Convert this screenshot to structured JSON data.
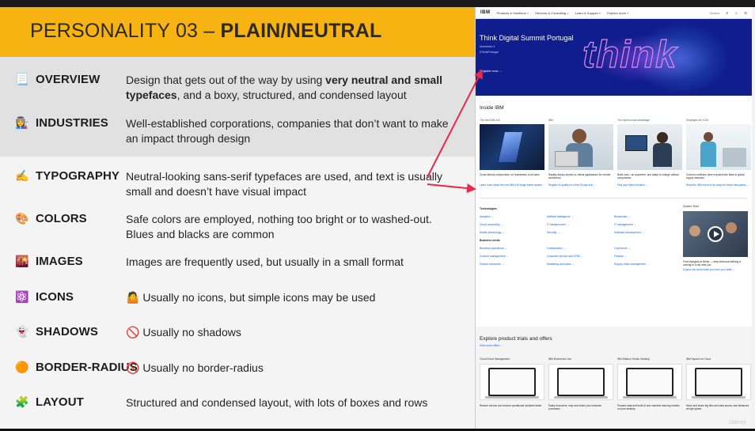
{
  "slide": {
    "title_prefix": "PERSONALITY 03 – ",
    "title_bold": "PLAIN/NEUTRAL",
    "rows": [
      {
        "emoji": "📃",
        "label": "OVERVIEW",
        "desc_parts": [
          "Design that gets out of the way by using ",
          "very neutral and small typefaces",
          ", and a boxy, structured, and condensed layout"
        ]
      },
      {
        "emoji": "👩‍🏭",
        "label": "INDUSTRIES",
        "desc": "Well-established corporations, companies that don’t want to make an impact through design"
      },
      {
        "emoji": "✍️",
        "label": "TYPOGRAPHY",
        "desc": "Neutral-looking sans-serif typefaces are used, and text is usually small and doesn’t have visual impact"
      },
      {
        "emoji": "🎨",
        "label": "COLORS",
        "desc": "Safe colors are employed, nothing too bright or to washed-out. Blues and blacks are common"
      },
      {
        "emoji": "🌇",
        "label": "IMAGES",
        "desc": "Images are frequently used, but usually in a small format"
      },
      {
        "emoji": "⚛️",
        "label": "ICONS",
        "desc_emoji": "🤷",
        "desc": "Usually no icons, but simple icons may be used"
      },
      {
        "emoji": "👻",
        "label": "SHADOWS",
        "desc_emoji": "🚫",
        "desc": "Usually no shadows"
      },
      {
        "emoji": "🟠",
        "label": "BORDER-RADIUS",
        "desc_emoji": "🚫",
        "desc": "Usually no border-radius"
      },
      {
        "emoji": "🧩",
        "label": "LAYOUT",
        "desc": "Structured and condensed layout, with lots of boxes and rows"
      }
    ],
    "colors": {
      "accent": "#f6b311",
      "arrow": "#e8294a",
      "ibm_blue": "#0f1e8c",
      "ibm_link": "#0f62fe"
    }
  },
  "ibm": {
    "logo": "IBM",
    "nav": [
      "Products & Solutions ˅",
      "Services & Consulting ˅",
      "Learn & Support ˅",
      "Explore more ˅"
    ],
    "search": "Search",
    "hero": {
      "title": "Think Digital Summit Portugal",
      "date": "November 4",
      "hashtag": "#ThinkPortugal",
      "link": "Register now →",
      "art_word": "think"
    },
    "inside_title": "Inside IBM",
    "cards": [
      {
        "caption": "The new IBM z15",
        "text": "Cloud without compromise, for businesses of all sizes",
        "link": "Learn more about the new IBM z15 single frame system →"
      },
      {
        "caption": "IBM",
        "text": "Rapidly deploy access to critical applications for remote workforces",
        "link": "Register to qualify for a free 60-day trial →"
      },
      {
        "caption": "The hybrid cloud advantage",
        "text": "Build once, run anywhere, and adapt to change without compromise",
        "link": "Find your hybrid solution →"
      },
      {
        "caption": "Strategies for SCM",
        "text": "Current conditions have exposed dire flaws in global supply networks",
        "link": "Read the IBM report to be ready for future disruptions →"
      }
    ],
    "tech_head": "Technologies",
    "tech": [
      [
        "Analytics →",
        "Artificial intelligence →",
        "Blockchain →"
      ],
      [
        "Cloud computing →",
        "IT infrastructure →",
        "IT management →"
      ],
      [
        "Mobile technology →",
        "Security →",
        "Software development →"
      ]
    ],
    "biz_head": "Business needs",
    "biz": [
      [
        "Business operations →",
        "Collaboration →",
        "Commerce →"
      ],
      [
        "Content management →",
        "Customer service and CRM →",
        "Finance →"
      ],
      [
        "Human resources →",
        "Marketing and sales →",
        "Supply chain management →"
      ]
    ],
    "video": {
      "caption": "System Tech!",
      "text": "From Bangkok to Berlin — deep technical training is coming to a city near you",
      "link": "Explore the world while you hone your skills →"
    },
    "trials_title": "Explore product trials and offers",
    "trials_link": "View more offers →",
    "trials": [
      {
        "caption": "Cloud Event Management",
        "text": "Restore service and resolve operational incidents faster"
      },
      {
        "caption": "IBM Blueworks Live",
        "text": "Easily document, map and share your business processes"
      },
      {
        "caption": "IBM Watson Studio Desktop",
        "text": "Prepare data and build AI and machine learning models on your desktop"
      },
      {
        "caption": "IBM Aspera on Cloud",
        "text": "Move and share big files and data across vast distances at high speed"
      }
    ],
    "watermark": "Udemy"
  }
}
